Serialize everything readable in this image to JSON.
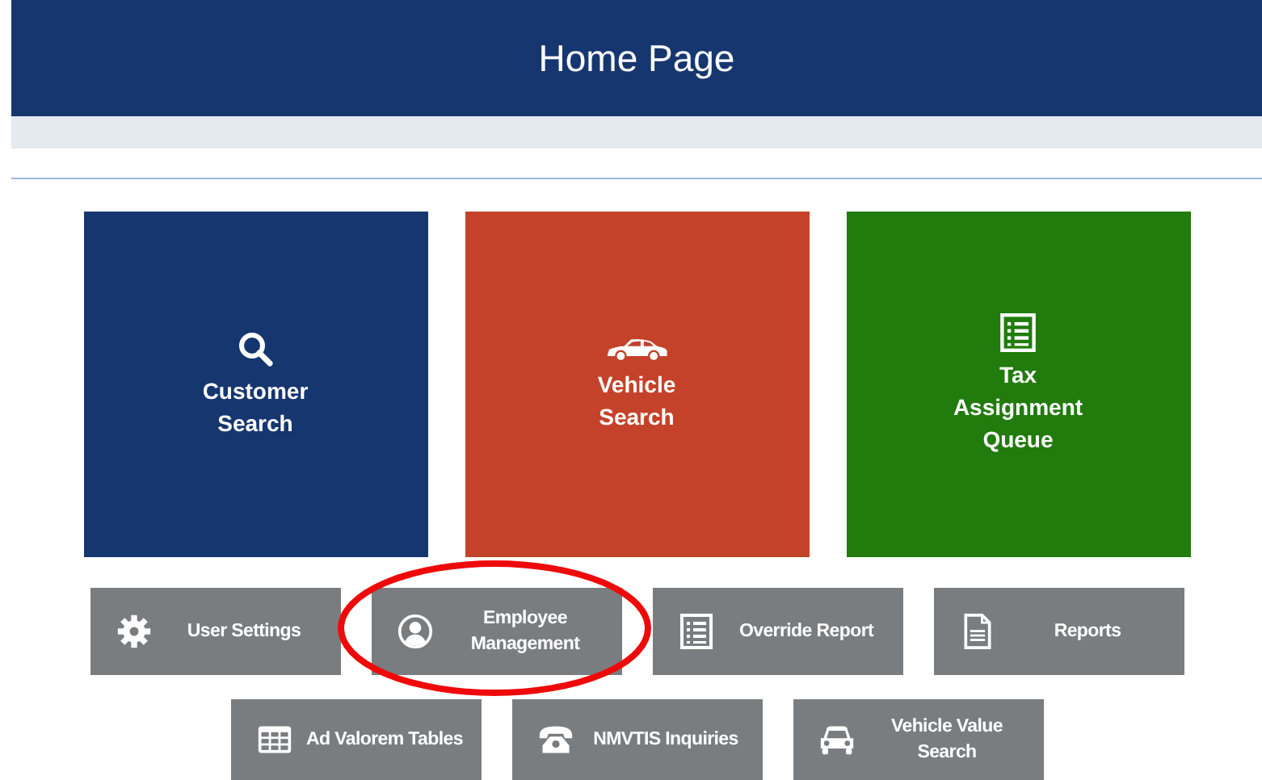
{
  "header": {
    "title": "Home Page"
  },
  "tiles": [
    {
      "label": "Customer Search",
      "kind": "search",
      "color": "#163670"
    },
    {
      "label": "Vehicle Search",
      "kind": "car",
      "color": "#c4422a"
    },
    {
      "label": "Tax Assignment Queue",
      "kind": "list",
      "color": "#217b0d"
    }
  ],
  "button_rows": [
    [
      {
        "label": "User Settings",
        "kind": "gear",
        "circled": false
      },
      {
        "label": "Employee Management",
        "kind": "user",
        "circled": true
      },
      {
        "label": "Override Report",
        "kind": "list",
        "circled": false
      },
      {
        "label": "Reports",
        "kind": "document",
        "circled": false
      }
    ],
    [
      {
        "label": "Ad Valorem Tables",
        "kind": "table",
        "circled": false
      },
      {
        "label": "NMVTIS Inquiries",
        "kind": "phone",
        "circled": false
      },
      {
        "label": "Vehicle Value Search",
        "kind": "carfront",
        "circled": false
      }
    ]
  ]
}
